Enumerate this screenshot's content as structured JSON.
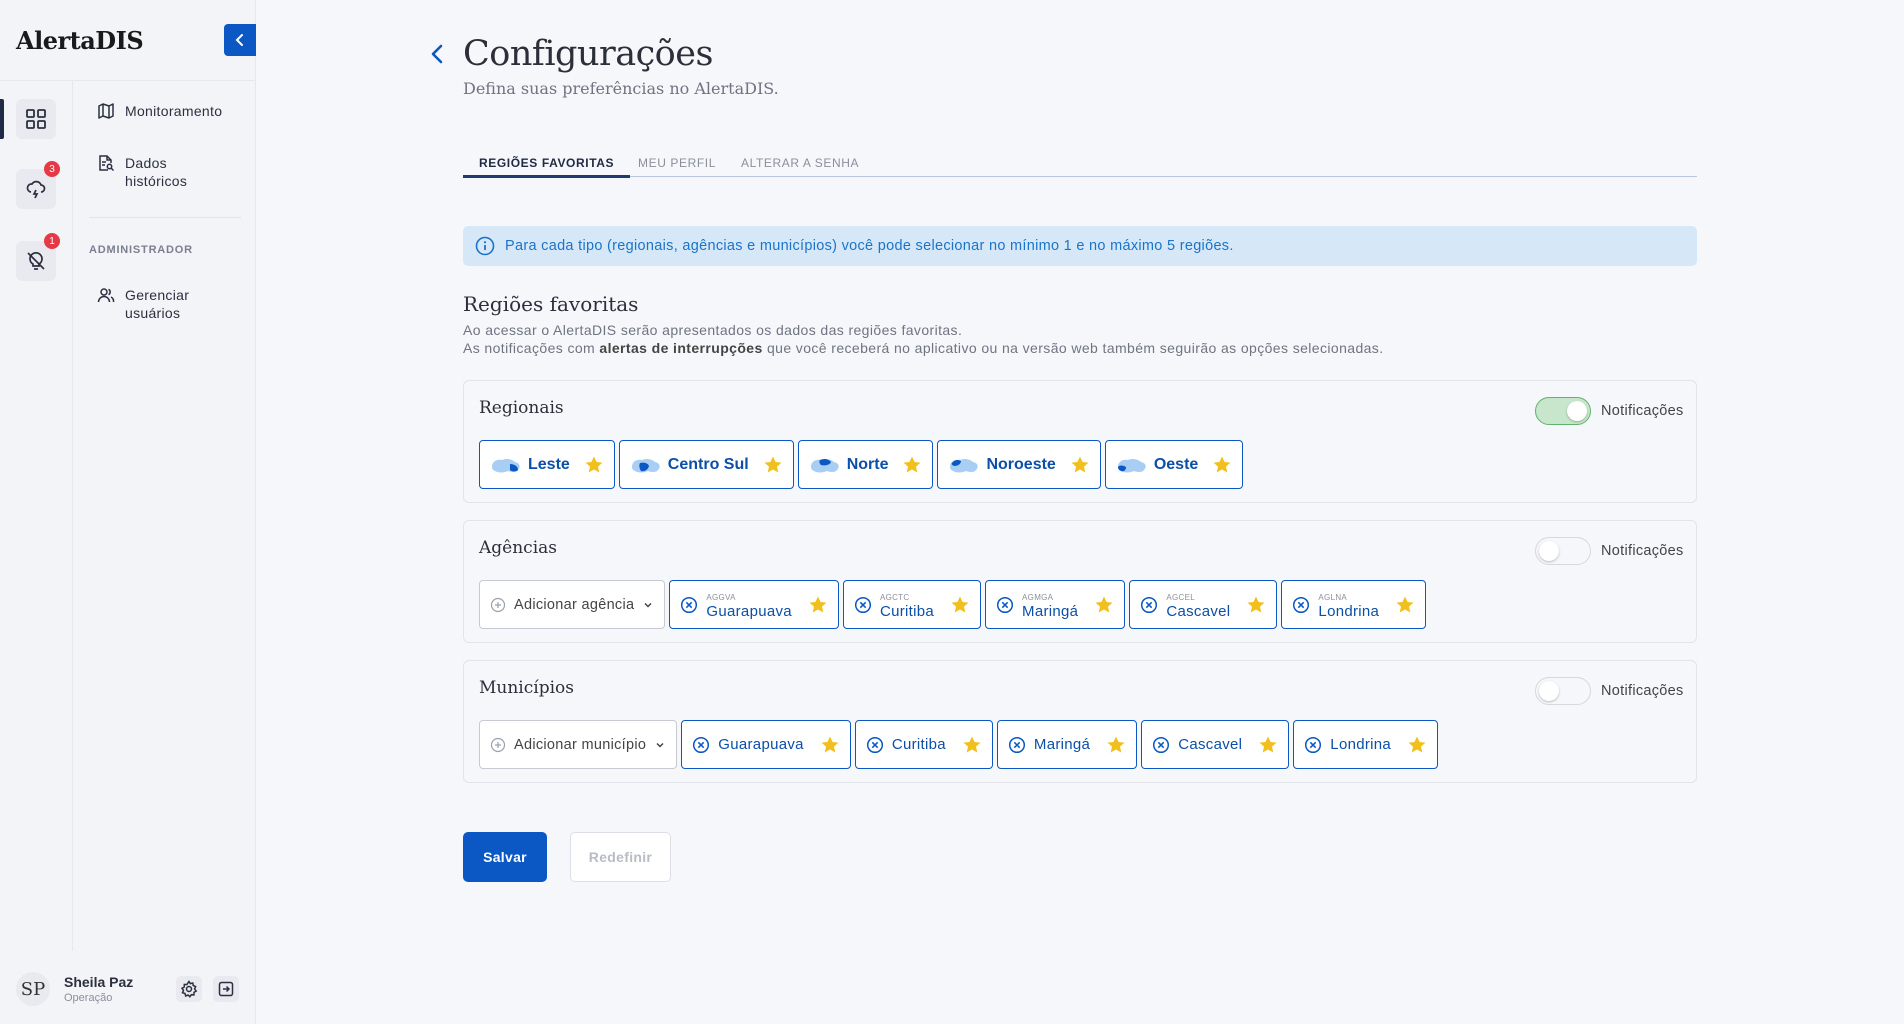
{
  "app": {
    "brand": "AlertaDIS"
  },
  "rail": {
    "badge_alerts": "3",
    "badge_outages": "1"
  },
  "nav": {
    "items": [
      {
        "label": "Monitoramento"
      },
      {
        "label_line1": "Dados",
        "label_line2": "históricos"
      },
      {
        "label_line1": "Gerenciar",
        "label_line2": "usuários"
      }
    ],
    "section_admin": "ADMINISTRADOR"
  },
  "user": {
    "initials": "SP",
    "name": "Sheila Paz",
    "role": "Operação"
  },
  "page": {
    "title": "Configurações",
    "subtitle": "Defina suas preferências no AlertaDIS."
  },
  "tabs": [
    {
      "label": "REGIÕES FAVORITAS",
      "active": true
    },
    {
      "label": "MEU PERFIL"
    },
    {
      "label": "ALTERAR A SENHA"
    }
  ],
  "info": "Para cada tipo (regionais, agências e municípios) você pode selecionar no mínimo 1 e no máximo 5 regiões.",
  "section": {
    "title": "Regiões favoritas",
    "desc_line1": "Ao acessar o AlertaDIS serão apresentados os dados das regiões favoritas.",
    "desc_line2_pre": "As notificações com ",
    "desc_line2_bold": "alertas de interrupções",
    "desc_line2_post": " que você receberá no aplicativo ou na versão web também seguirão as opções selecionadas."
  },
  "regionais": {
    "title": "Regionais",
    "toggle_label": "Notificações",
    "notifications_on": true,
    "chips": [
      "Leste",
      "Centro Sul",
      "Norte",
      "Noroeste",
      "Oeste"
    ]
  },
  "agencias": {
    "title": "Agências",
    "toggle_label": "Notificações",
    "notifications_on": false,
    "add_label": "Adicionar agência",
    "chips": [
      {
        "code": "AGGVA",
        "name": "Guarapuava"
      },
      {
        "code": "AGCTC",
        "name": "Curitiba"
      },
      {
        "code": "AGMGA",
        "name": "Maringá"
      },
      {
        "code": "AGCEL",
        "name": "Cascavel"
      },
      {
        "code": "AGLNA",
        "name": "Londrina"
      }
    ]
  },
  "municipios": {
    "title": "Municípios",
    "toggle_label": "Notificações",
    "notifications_on": false,
    "add_label": "Adicionar município",
    "chips": [
      "Guarapuava",
      "Curitiba",
      "Maringá",
      "Cascavel",
      "Londrina"
    ]
  },
  "actions": {
    "save": "Salvar",
    "reset": "Redefinir"
  },
  "colors": {
    "primary": "#0b57c4",
    "star": "#f2c01e",
    "info_bg": "#d6e8f8",
    "info_text": "#1a74c9",
    "toggle_on": "#c7e6cb"
  }
}
